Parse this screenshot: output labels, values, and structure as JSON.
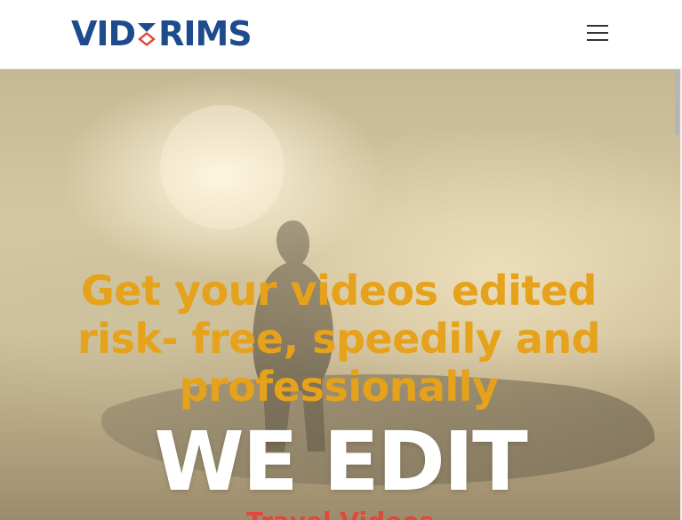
{
  "header": {
    "logo_left": "VID",
    "logo_right": "RIMS",
    "logo_alt": "VIDTRIMS",
    "menu_icon": "hamburger-menu-icon"
  },
  "hero": {
    "headline": "Get your videos edited risk- free, speedily and professionally",
    "tagline": "WE EDIT",
    "subline_partial": "Travel Videos",
    "background_image": "surfer-silhouette-photo"
  },
  "colors": {
    "brand_blue": "#1e4b8e",
    "brand_red": "#e0483e",
    "headline_orange": "#e5a21a",
    "tagline_white": "#ffffff"
  }
}
